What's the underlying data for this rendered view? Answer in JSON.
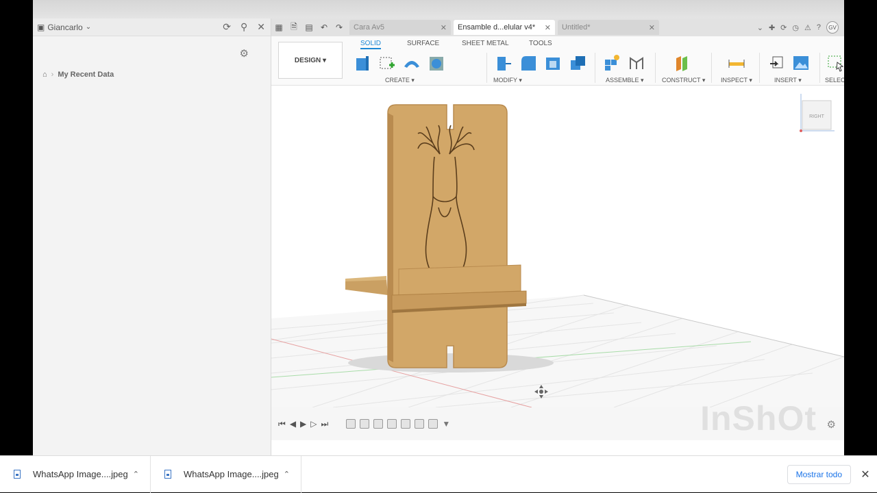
{
  "data_panel": {
    "user": "Giancarlo",
    "breadcrumb": "My Recent Data"
  },
  "doc_tabs": [
    {
      "label": "Cara Av5",
      "active": false
    },
    {
      "label": "Ensamble d...elular v4*",
      "active": true
    },
    {
      "label": "Untitled*",
      "active": false
    }
  ],
  "avatar": "GV",
  "toolbar": {
    "workspace": "DESIGN",
    "tabs": [
      "SOLID",
      "SURFACE",
      "SHEET METAL",
      "TOOLS"
    ],
    "groups": [
      "CREATE",
      "MODIFY",
      "ASSEMBLE",
      "CONSTRUCT",
      "INSPECT",
      "INSERT",
      "SELECT"
    ]
  },
  "viewcube": "RIGHT",
  "watermark": "InShOt",
  "downloads": {
    "items": [
      {
        "name": "WhatsApp Image....jpeg"
      },
      {
        "name": "WhatsApp Image....jpeg"
      }
    ],
    "show_all": "Mostrar todo"
  },
  "colors": {
    "accent": "#1c87d4",
    "wood": "#d2a768",
    "wood_dark": "#b98b4f"
  }
}
